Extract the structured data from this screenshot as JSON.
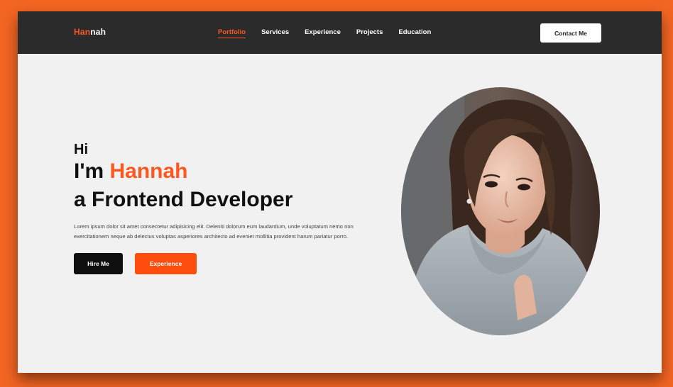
{
  "header": {
    "logo_accent": "Han",
    "logo_rest": "nah",
    "nav": [
      {
        "label": "Portfolio",
        "active": true
      },
      {
        "label": "Services",
        "active": false
      },
      {
        "label": "Experience",
        "active": false
      },
      {
        "label": "Projects",
        "active": false
      },
      {
        "label": "Education",
        "active": false
      }
    ],
    "contact_label": "Contact Me"
  },
  "hero": {
    "greeting": "Hi",
    "im": "I'm ",
    "name": "Hannah",
    "role": "a Frontend Developer",
    "description": "Lorem ipsum dolor sit amet consectetur adipisicing elit. Deleniti dolorum eum laudantium, unde voluptatum nemo non exercitationem neque ab delectus voluptas asperiores architecto ad eveniet mollitia provident harum pariatur porro.",
    "hire_label": "Hire Me",
    "experience_label": "Experience"
  },
  "colors": {
    "accent": "#ff5722",
    "background_frame": "#f26522",
    "navbar": "#2b2b2b",
    "page": "#f1f1f1"
  },
  "image": {
    "subject": "portrait-photo"
  }
}
